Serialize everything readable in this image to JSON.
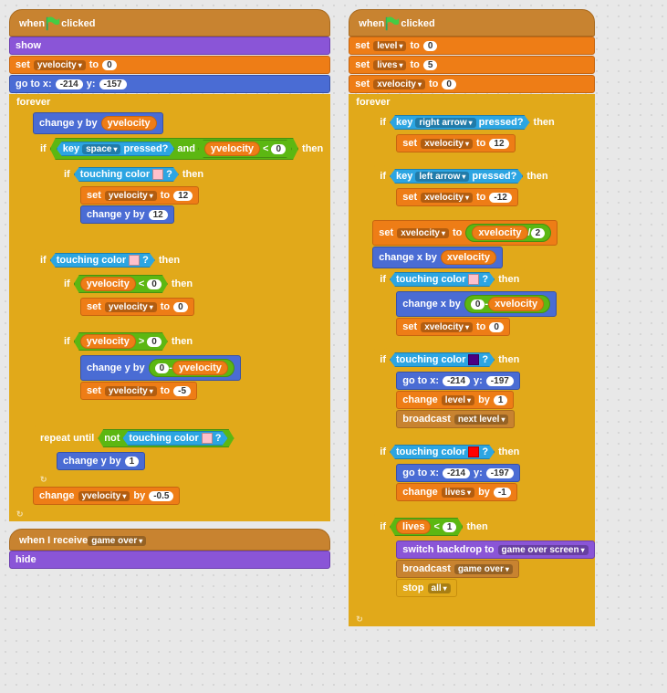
{
  "flag_clicked": "clicked",
  "when": "when",
  "when_receive": "when I receive",
  "show": "show",
  "hide": "hide",
  "set": "set",
  "to": "to",
  "go_to_xy": "go to x:",
  "y_lbl": "y:",
  "forever": "forever",
  "if": "if",
  "then": "then",
  "change_y_by": "change y by",
  "change_x_by": "change x by",
  "change": "change",
  "by": "by",
  "key": "key",
  "pressed": "pressed?",
  "and": "and",
  "touching_color": "touching color",
  "q": "?",
  "repeat_until": "repeat until",
  "not": "not",
  "broadcast": "broadcast",
  "switch_backdrop": "switch backdrop to",
  "stop": "stop",
  "vars": {
    "yvel": "yvelocity",
    "xvel": "xvelocity",
    "level": "level",
    "lives": "lives"
  },
  "msg": {
    "game_over": "game over",
    "next_level": "next level",
    "backdrop": "game over screen"
  },
  "keys": {
    "space": "space",
    "right": "right arrow",
    "left": "left arrow"
  },
  "stop_opt": "all",
  "nums": {
    "zero": "0",
    "one": "1",
    "five": "5",
    "twelve": "12",
    "neg12": "-12",
    "two": "2",
    "neg05": "-0.5",
    "neg5": "-5",
    "neg1": "-1",
    "x214": "-214",
    "y157": "-157",
    "y197": "-197"
  },
  "ops": {
    "lt": "<",
    "gt": ">",
    "minus": "-",
    "div": "/"
  },
  "colors": {
    "pink": "#ffc0cb",
    "purple": "#4b0082",
    "red": "#ff0000"
  }
}
